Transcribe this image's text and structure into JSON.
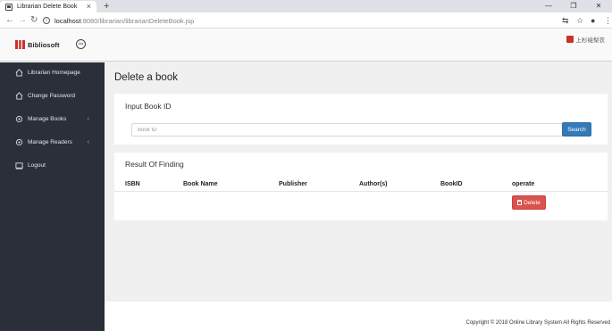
{
  "browser": {
    "tab_title": "Librarian Delete Book",
    "tab_close": "×",
    "new_tab": "+",
    "url_host": "localhost",
    "url_path": ":8080/librarian/librarianDeleteBook.jsp",
    "min": "—",
    "max": "❐",
    "close": "✕"
  },
  "header": {
    "logo_text": "Bibliosoft",
    "user_name": "上杉绘梨衣"
  },
  "sidebar": {
    "items": [
      {
        "label": "Librarian Homepage",
        "arrow": ""
      },
      {
        "label": "Change Password",
        "arrow": ""
      },
      {
        "label": "Manage Books",
        "arrow": "‹"
      },
      {
        "label": "Manage Readers",
        "arrow": "‹"
      },
      {
        "label": "Logout",
        "arrow": ""
      }
    ]
  },
  "main": {
    "title": "Delete a book",
    "input_section": {
      "title": "Input Book ID",
      "placeholder": "Book ID",
      "value": "",
      "button": "Search"
    },
    "result_section": {
      "title": "Result Of Finding",
      "columns": [
        "ISBN",
        "Book Name",
        "Publisher",
        "Author(s)",
        "BookID",
        "operate"
      ],
      "delete_button": "Delete"
    }
  },
  "footer": {
    "copyright": "Copyright © 2018 Online Library System All Rights Reserved"
  },
  "colors": {
    "sidebar_bg": "#2a2f3a",
    "primary": "#337ab7",
    "danger": "#d9534f"
  }
}
